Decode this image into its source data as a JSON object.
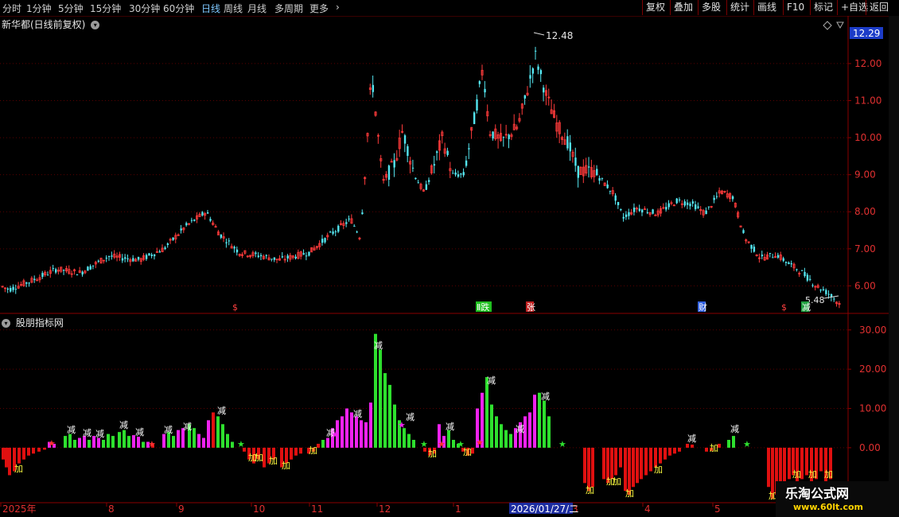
{
  "toolbar": {
    "timeframes": [
      "分时",
      "1分钟",
      "5分钟",
      "15分钟",
      "30分钟",
      "60分钟",
      "日线",
      "周线",
      "月线",
      "多周期",
      "更多"
    ],
    "active_timeframe": "日线",
    "buttons": [
      "复权",
      "叠加",
      "多股",
      "统计",
      "画线",
      "F10",
      "标记",
      "+自选",
      "返回"
    ]
  },
  "main_chart": {
    "title": "新华都(日线前复权)",
    "current_price": "12.29",
    "high_label": "12.48",
    "low_label": "5.48",
    "ylim": [
      5.3,
      12.9
    ],
    "y_ticks": [
      6.0,
      7.0,
      8.0,
      9.0,
      10.0,
      11.0,
      12.0
    ],
    "y_tick_labels": [
      "6.00",
      "7.00",
      "8.00",
      "9.00",
      "10.00",
      "11.00",
      "12.00"
    ],
    "markers": [
      "$",
      "Ⅱ跌",
      "张",
      "财",
      "$",
      "减"
    ]
  },
  "indicator": {
    "title": "股朋指标网",
    "ylim": [
      -14,
      33
    ],
    "y_ticks": [
      0,
      10,
      20,
      30
    ],
    "y_tick_labels": [
      "0.00",
      "10.00",
      "20.00",
      "30.00"
    ],
    "sell_label": "减",
    "buy_label": "加"
  },
  "x_axis": {
    "labels": [
      "2025年",
      "8",
      "9",
      "10",
      "11",
      "12",
      "1",
      "3",
      "4",
      "5"
    ],
    "cursor_label": "2026/01/27/二"
  },
  "watermark": {
    "line1": "乐淘公式网",
    "line2": "www.60lt.com"
  },
  "colors": {
    "up": "#ff3b3b",
    "down": "#54e6f0",
    "green": "#2ee02e",
    "magenta": "#ee22ee",
    "red_bar": "#e01010",
    "axis": "#8a0000"
  }
}
